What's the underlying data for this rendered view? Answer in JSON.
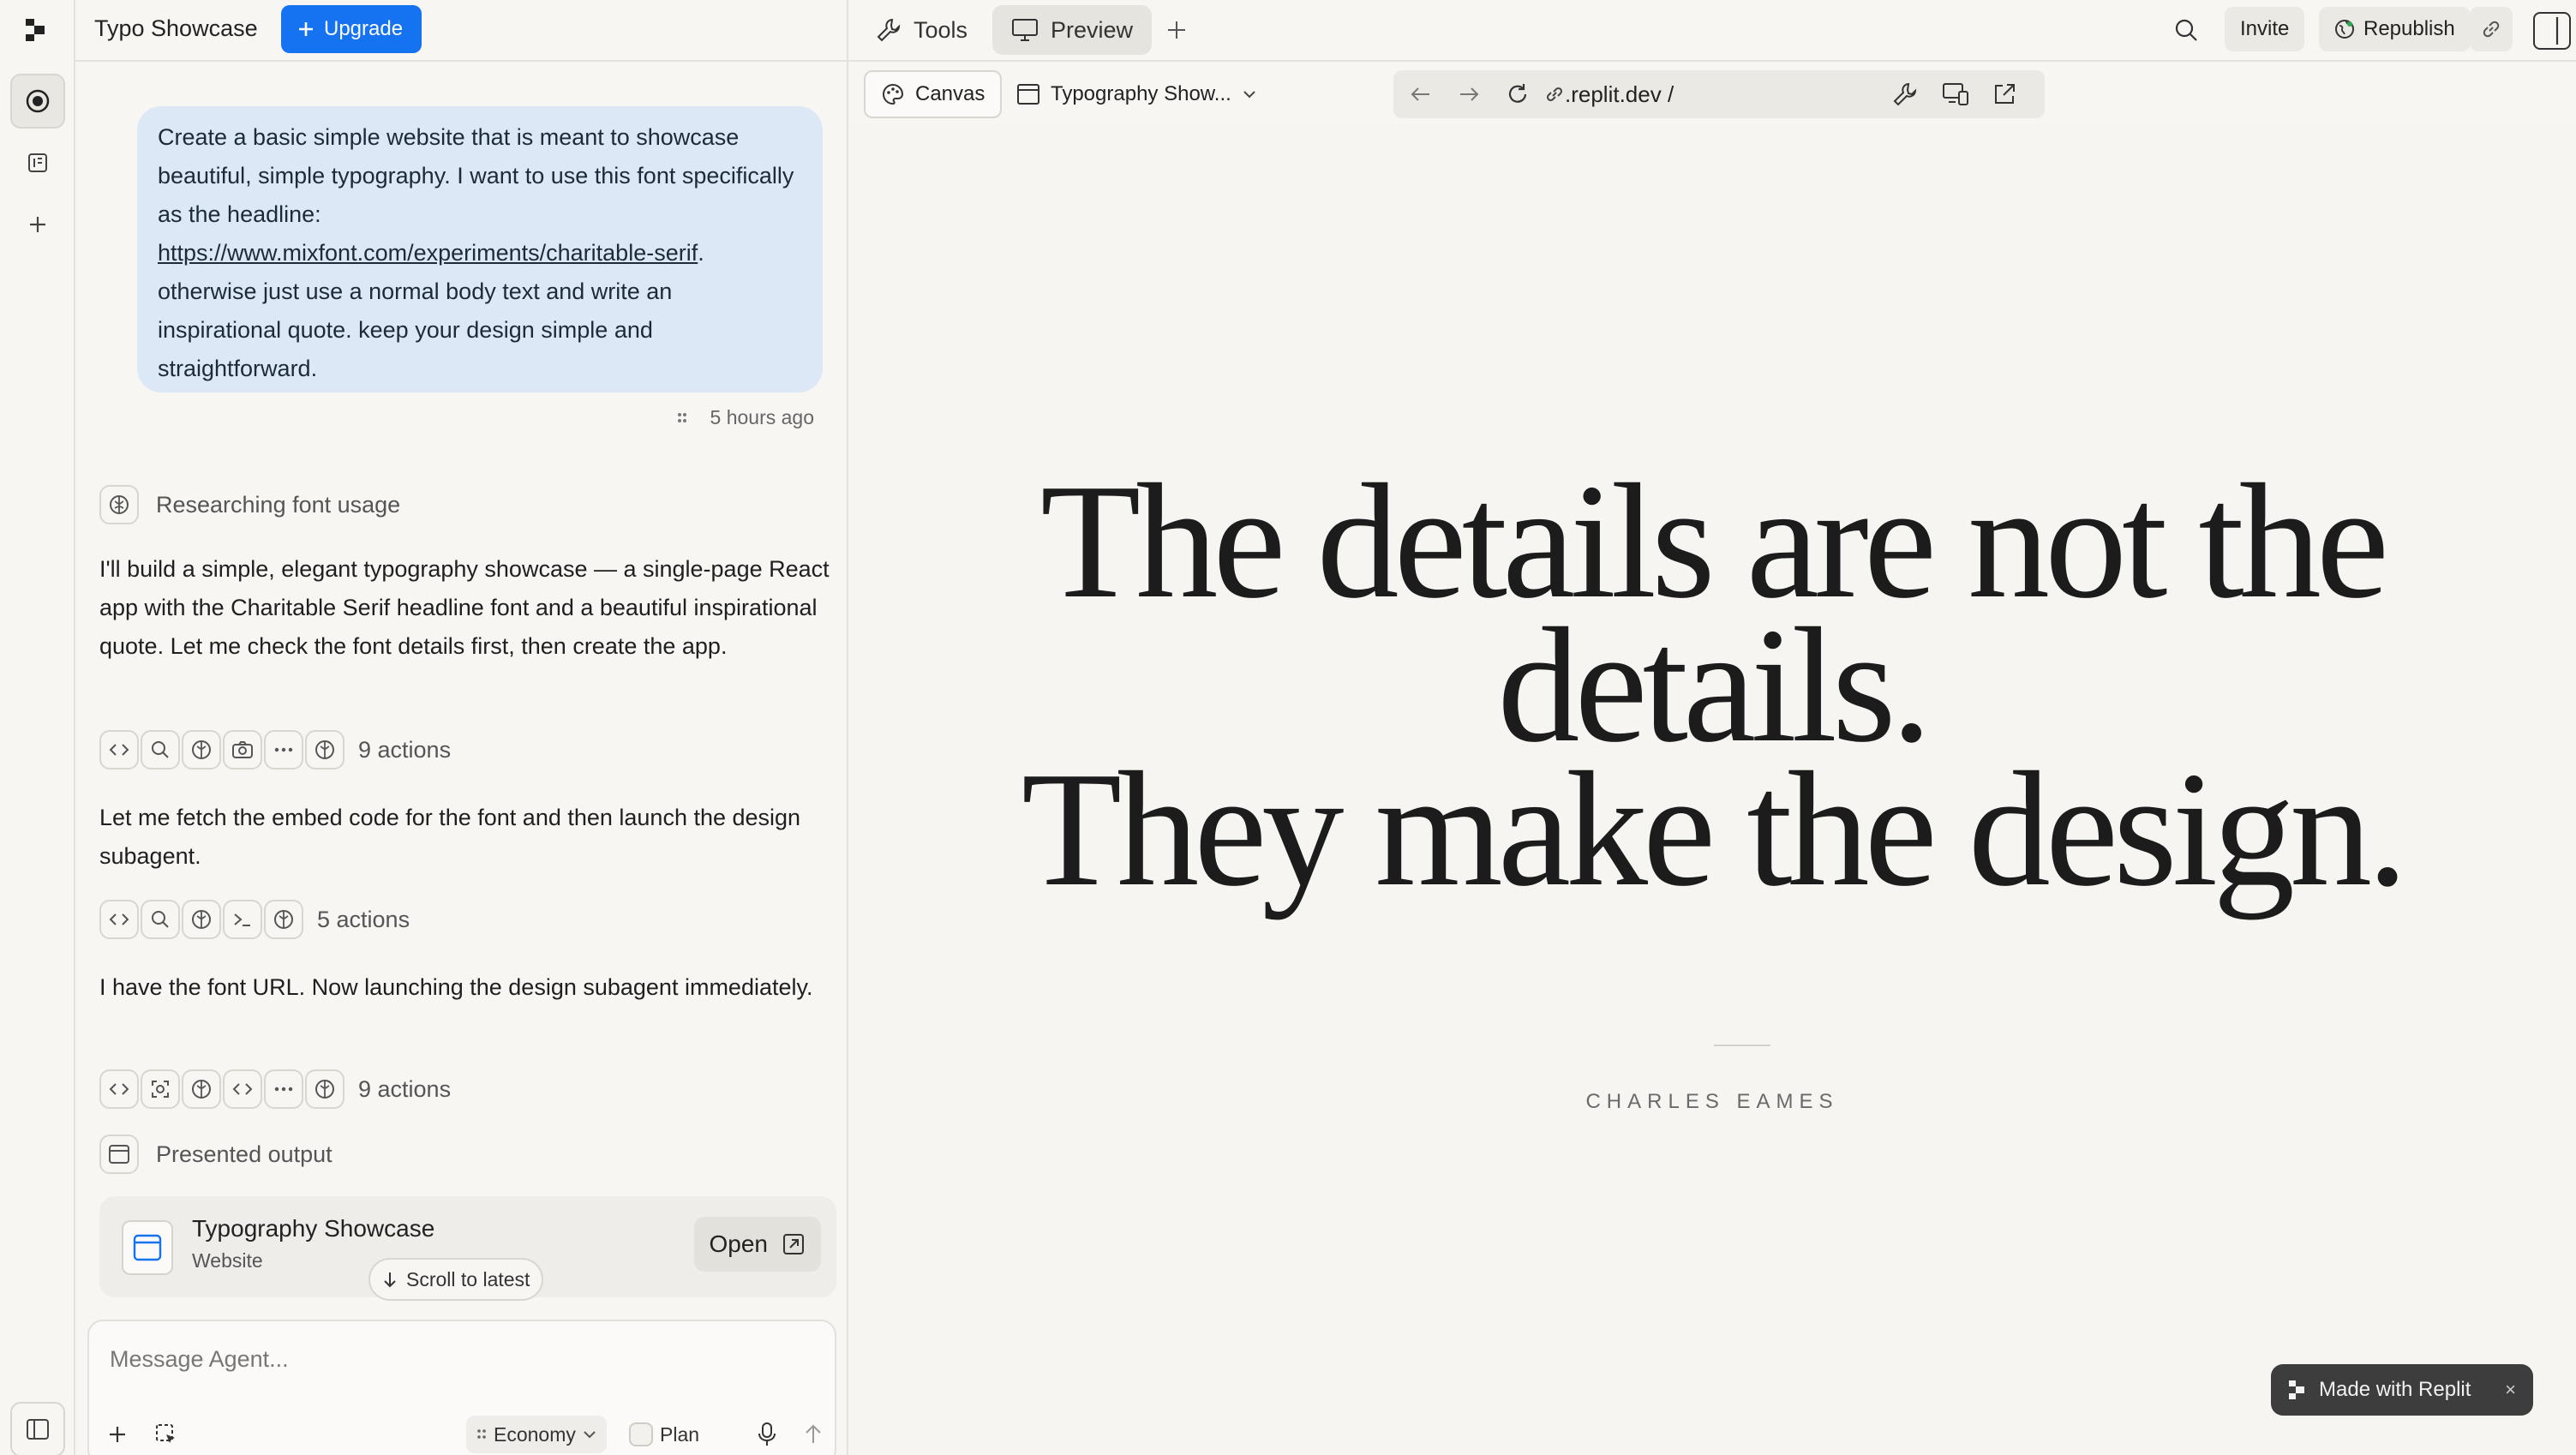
{
  "colors": {
    "accent": "#1572f0",
    "bubble": "#dde8f6",
    "background": "#f7f6f3",
    "badge": "#3d3d3d"
  },
  "header": {
    "project_title": "Typo Showcase",
    "upgrade_label": "Upgrade"
  },
  "chat": {
    "user_message": {
      "before_link": "Create a basic simple website that is meant to showcase beautiful, simple typography. I want to use this font specifically as the headline:",
      "link": "https://www.mixfont.com/experiments/charitable-serif",
      "after_link": ". otherwise just use a normal body text and write an inspirational quote. keep your design simple and straightforward.",
      "time": "5 hours ago"
    },
    "research_step": "Researching font usage",
    "messages": [
      "I'll build a simple, elegant typography showcase — a single-page React app with the Charitable Serif headline font and a beautiful inspirational quote. Let me check the font details first, then create the app.",
      "Let me fetch the embed code for the font and then launch the design subagent.",
      "I have the font URL. Now launching the design subagent immediately."
    ],
    "action_groups": [
      {
        "count_label": "9 actions",
        "icons": [
          "code-icon",
          "search-icon",
          "brain-icon",
          "camera-icon",
          "more-icon",
          "brain-icon"
        ]
      },
      {
        "count_label": "5 actions",
        "icons": [
          "code-icon",
          "search-icon",
          "brain-icon",
          "terminal-icon",
          "brain-icon"
        ]
      },
      {
        "count_label": "9 actions",
        "icons": [
          "code-icon",
          "screenshot-icon",
          "brain-icon",
          "code-icon",
          "more-icon",
          "brain-icon"
        ]
      }
    ],
    "presented_output": "Presented output",
    "output_card": {
      "title": "Typography Showcase",
      "subtitle": "Website",
      "open_label": "Open"
    },
    "scroll_to_latest": "Scroll to latest"
  },
  "composer": {
    "placeholder": "Message Agent...",
    "mode_label": "Economy",
    "plan_label": "Plan"
  },
  "topbar": {
    "tools_label": "Tools",
    "preview_label": "Preview",
    "invite_label": "Invite",
    "republish_label": "Republish"
  },
  "preview_toolbar": {
    "canvas_label": "Canvas",
    "page_label": "Typography Show...",
    "url": ".replit.dev /"
  },
  "preview": {
    "quote_line1": "The details are not the",
    "quote_line2": "details.",
    "quote_line3": "They make the design.",
    "author": "CHARLES EAMES",
    "badge_label": "Made with Replit",
    "badge_close": "×"
  }
}
